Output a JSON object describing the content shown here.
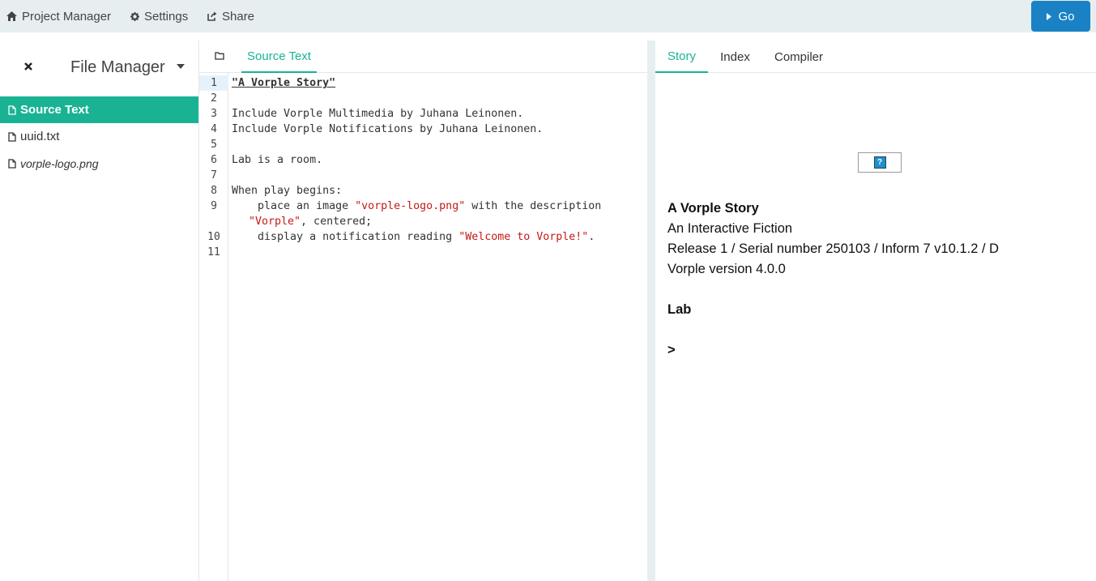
{
  "topbar": {
    "project_manager": "Project Manager",
    "settings": "Settings",
    "share": "Share",
    "go": "Go"
  },
  "file_manager": {
    "title": "File Manager",
    "files": [
      {
        "name": "Source Text",
        "active": true
      },
      {
        "name": "uuid.txt",
        "active": false
      },
      {
        "name": "vorple-logo.png",
        "active": false
      }
    ]
  },
  "editor": {
    "tab": "Source Text",
    "line_numbers": [
      "1",
      "2",
      "3",
      "4",
      "5",
      "6",
      "7",
      "8",
      "9",
      "10",
      "11"
    ],
    "lines": {
      "l1": "\"A Vorple Story\"",
      "l3": "Include Vorple Multimedia by Juhana Leinonen.",
      "l4": "Include Vorple Notifications by Juhana Leinonen.",
      "l6": "Lab is a room.",
      "l8": "When play begins:",
      "l9a": "    place an image ",
      "l9b": "\"vorple-logo.png\"",
      "l9c": " with the description",
      "l9d": "\"Vorple\"",
      "l9e": ", centered;",
      "l10a": "    display a notification reading ",
      "l10b": "\"Welcome to Vorple!\"",
      "l10c": "."
    }
  },
  "right_panel": {
    "tabs": [
      "Story",
      "Index",
      "Compiler"
    ],
    "active_tab": "Story",
    "image_placeholder": "?",
    "story": {
      "title": "A Vorple Story",
      "subtitle": "An Interactive Fiction",
      "release": "Release 1 / Serial number 250103 / Inform 7 v10.1.2 / D",
      "version": "Vorple version 4.0.0",
      "room": "Lab",
      "prompt": ">"
    }
  },
  "colors": {
    "accent": "#19b394",
    "go_button": "#1a82c4",
    "toolbar_bg": "#e7eef0",
    "string": "#c41a16"
  }
}
